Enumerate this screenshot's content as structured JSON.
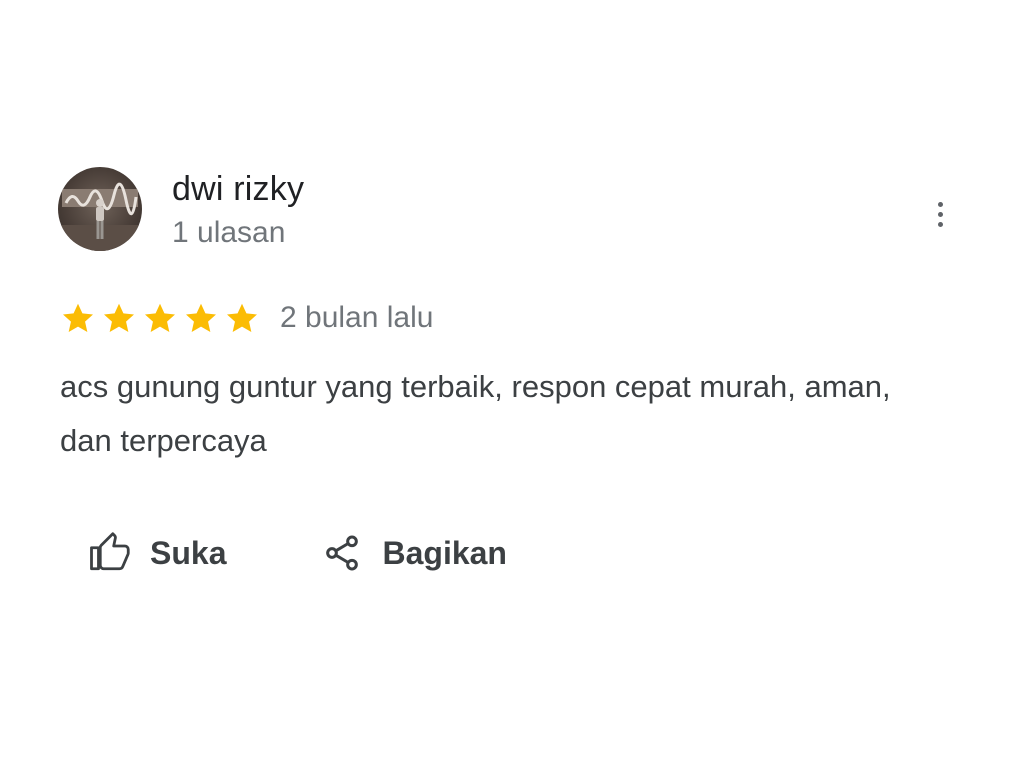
{
  "review": {
    "author": {
      "name": "dwi rizky",
      "review_count": "1 ulasan",
      "avatar_icon": "profile-photo"
    },
    "more_icon": "more-vert-icon",
    "rating": 5,
    "rating_max": 5,
    "date": "2 bulan lalu",
    "text": "acs gunung guntur yang terbaik, respon cepat murah, aman, dan terpercaya"
  },
  "actions": {
    "like_label": "Suka",
    "like_icon": "thumb-up-icon",
    "share_label": "Bagikan",
    "share_icon": "share-icon"
  },
  "colors": {
    "star": "#fbbc04",
    "text_primary": "#202124",
    "text_secondary": "#70757a",
    "text_body": "#3c4043"
  }
}
